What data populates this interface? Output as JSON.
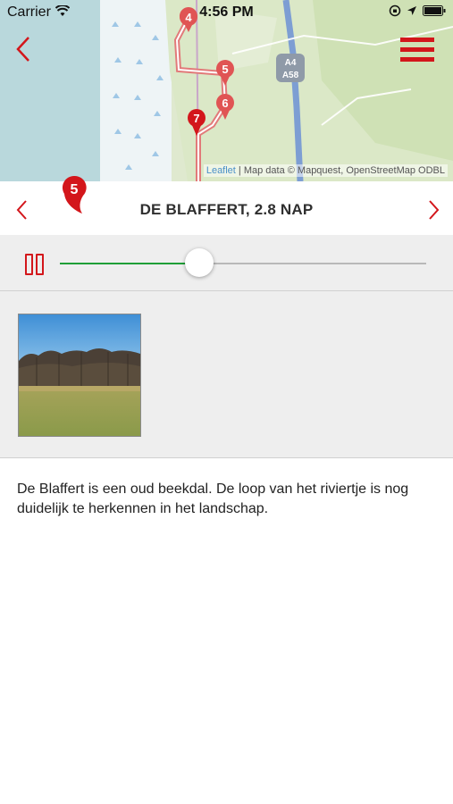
{
  "status_bar": {
    "carrier": "Carrier",
    "time": "4:56 PM"
  },
  "map": {
    "attribution_leaflet": "Leaflet",
    "attribution_rest": " | Map data © Mapquest, OpenStreetMap ODBL",
    "road_labels": [
      "A4",
      "A58"
    ],
    "markers": [
      "4",
      "5",
      "6",
      "7"
    ]
  },
  "stop": {
    "number": "5",
    "title": "DE BLAFFERT, 2.8 NAP"
  },
  "audio": {
    "state": "playing",
    "progress": 0.38
  },
  "gallery": {
    "images": [
      {
        "icon": "meadow-photo"
      }
    ]
  },
  "description": "De Blaffert is een oud beekdal. De loop van het riviertje is nog duidelijk te herkennen in het landschap.",
  "colors": {
    "accent": "#d3161b",
    "progress": "#1f9e37",
    "panel": "#eeeeee"
  }
}
